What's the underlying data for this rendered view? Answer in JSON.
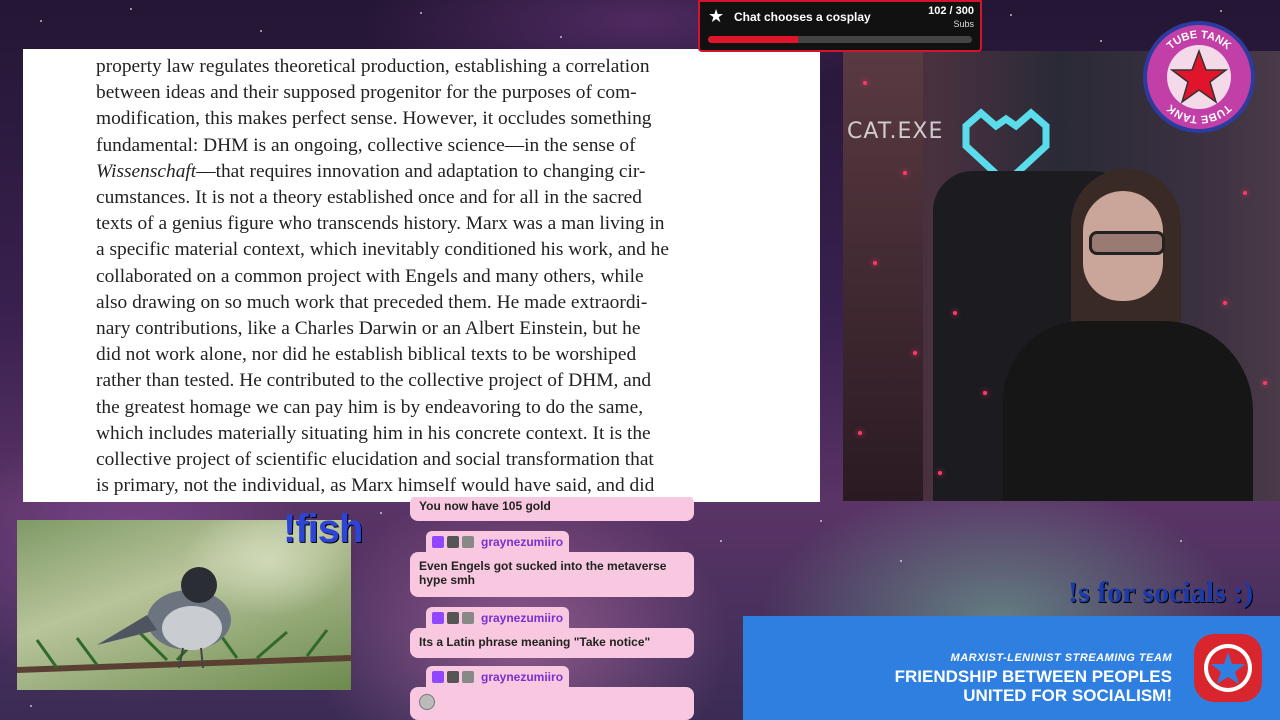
{
  "document": {
    "lines": [
      "property law regulates theoretical production, establishing a correlation",
      "between ideas and their supposed progenitor for the purposes of com-",
      "modification, this makes perfect sense. However, it occludes something",
      "fundamental: DHM is an ongoing, collective science—in the sense of",
      "Wissenschaft—that requires innovation and adaptation to changing cir-",
      "cumstances. It is not a theory established once and for all in the sacred",
      "texts of a genius figure who transcends history. Marx was a man living in",
      "a specific material context, which inevitably conditioned his work, and he",
      "collaborated on a common project with Engels and many others, while",
      "also drawing on so much work that preceded them. He made extraordi-",
      "nary contributions, like a Charles Darwin or an Albert Einstein, but he",
      "did not work alone, nor did he establish biblical texts to be worshiped",
      "rather than tested. He contributed to the collective project of DHM, and",
      "the greatest homage we can pay him is by endeavoring to do the same,",
      "which includes materially situating him in his concrete context. It is the",
      "collective project of scientific elucidation and social transformation that",
      "is primary, not the individual, as Marx himself would have said, and did"
    ]
  },
  "sub_goal": {
    "label": "Chat chooses a cosplay",
    "current": 102,
    "target": 300,
    "count_text": "102 / 300",
    "unit": "Subs",
    "progress_fraction": 0.34,
    "bar_color": "#e0142a"
  },
  "webcam": {
    "overlay_label": "CAT.EXE"
  },
  "logo": {
    "text_top": "TUBE TANK",
    "text_bottom": "TUBE TANK",
    "icon": "red-star-icon"
  },
  "command_fish": "!fish",
  "chat": {
    "partial_message": "You now have 105 gold",
    "messages": [
      {
        "user": "graynezumiiro",
        "text": "Even Engels got sucked into the metaverse hype smh"
      },
      {
        "user": "graynezumiiro",
        "text": "Its a Latin phrase meaning \"Take notice\""
      },
      {
        "user": "graynezumiiro",
        "text": ""
      }
    ],
    "username_color": "#7a2fd0",
    "bubble_color": "#f7c8df"
  },
  "socials_text": "!s for socials :)",
  "banner": {
    "line1": "MARXIST-LENINIST STREAMING TEAM",
    "line2": "FRIENDSHIP BETWEEN PEOPLES",
    "line3": "UNITED FOR SOCIALISM!",
    "background": "#2e7fe0"
  }
}
